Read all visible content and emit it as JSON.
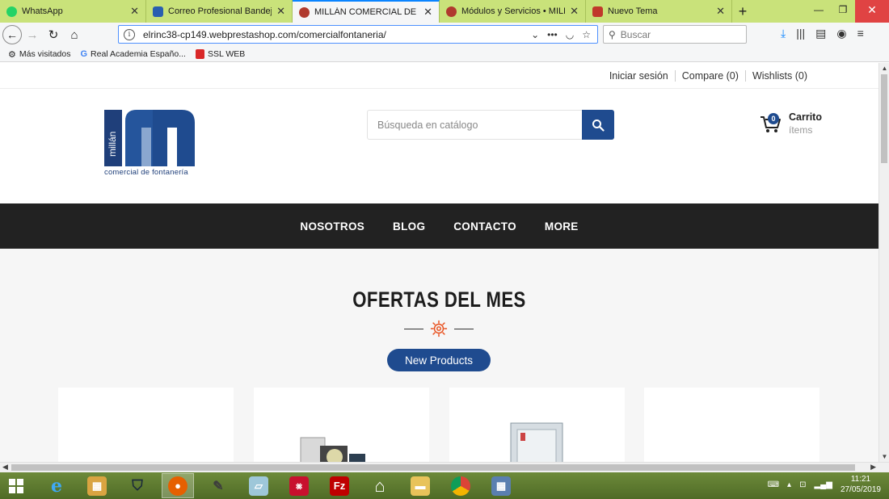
{
  "browser": {
    "tabs": [
      {
        "label": "WhatsApp",
        "favicon_color": "#25d366"
      },
      {
        "label": "Correo Profesional Bandeja de",
        "favicon_color": "#2a5fb0"
      },
      {
        "label": "MILLÁN COMERCIAL DE FONT",
        "favicon_color": "#b03a2e",
        "active": true
      },
      {
        "label": "Módulos y Servicios • MILLÁN",
        "favicon_color": "#b03a2e"
      },
      {
        "label": "Nuevo Tema",
        "favicon_color": "#c0392b"
      }
    ],
    "url": "elrinc38-cp149.webprestashop.com/comercialfontaneria/",
    "search_placeholder": "Buscar",
    "bookmarks": [
      {
        "label": "Más visitados",
        "icon": "gear-icon"
      },
      {
        "label": "Real Academia Españo...",
        "icon": "google-icon"
      },
      {
        "label": "SSL WEB",
        "icon": "shield-icon"
      }
    ]
  },
  "site": {
    "top_links": {
      "login": "Iniciar sesión",
      "compare": "Compare (0)",
      "wishlists": "Wishlists (0)"
    },
    "logo_tagline": "comercial de fontanería",
    "logo_vertical": "millán",
    "search_placeholder": "Búsqueda en catálogo",
    "cart": {
      "title": "Carrito",
      "subtitle": "ítems",
      "count": "0"
    },
    "menu": [
      "NOSOTROS",
      "BLOG",
      "CONTACTO",
      "MORE"
    ],
    "section_title": "OFERTAS DEL MES",
    "pill_label": "New Products",
    "brand_color": "#1f4b8f"
  },
  "taskbar": {
    "time": "11:21",
    "date": "27/05/2019"
  }
}
